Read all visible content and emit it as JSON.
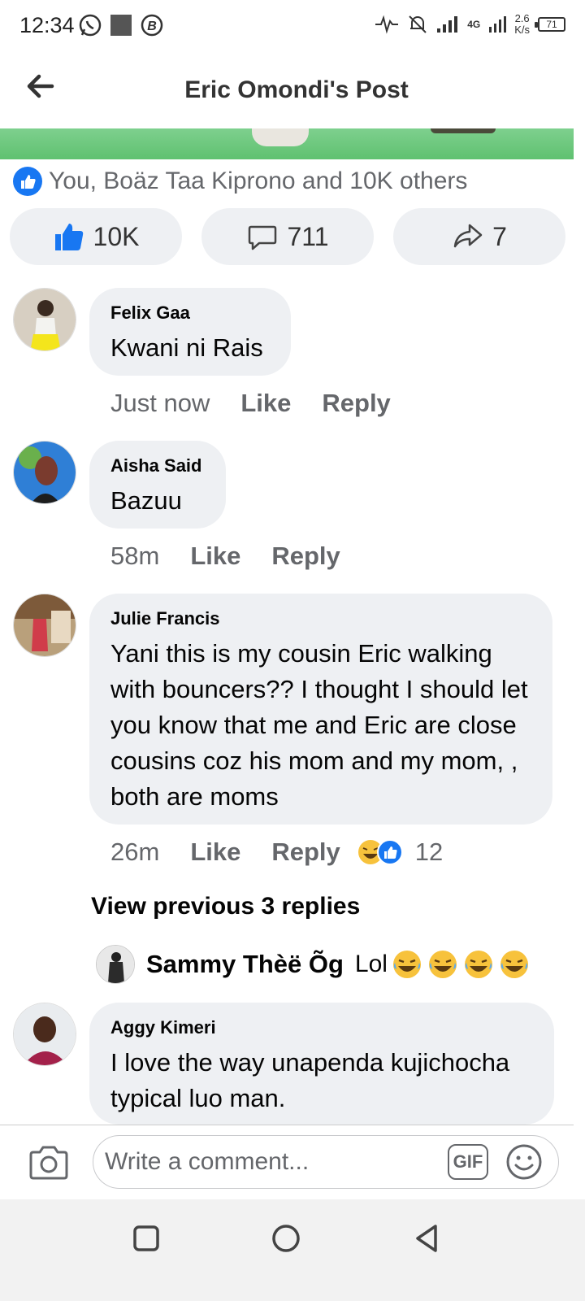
{
  "status": {
    "time": "12:34",
    "network": "4G",
    "speed_value": "2.6",
    "speed_unit": "K/s",
    "battery": "71"
  },
  "header": {
    "title": "Eric Omondi's Post"
  },
  "reactions_summary": "You, Boäz Taa Kiprono and 10K others",
  "actions": {
    "likes": "10K",
    "comments": "711",
    "shares": "7"
  },
  "comments": [
    {
      "name": "Felix Gaa",
      "text": "Kwani ni Rais",
      "time": "Just now",
      "like": "Like",
      "reply": "Reply"
    },
    {
      "name": "Aisha Said",
      "text": "Bazuu",
      "time": "58m",
      "like": "Like",
      "reply": "Reply"
    },
    {
      "name": "Julie Francis",
      "text": "Yani this is my cousin Eric walking with bouncers?? I thought I should let you know that me and Eric are close cousins coz his mom and my mom, , both are moms",
      "time": "26m",
      "like": "Like",
      "reply": "Reply",
      "reaction_count": "12"
    },
    {
      "name": "Aggy Kimeri",
      "text": "I love the way unapenda kujichocha typical luo man."
    }
  ],
  "view_previous": "View previous 3 replies",
  "latest_reply": {
    "name": "Sammy Thèë Õg",
    "text": "Lol"
  },
  "composer": {
    "placeholder": "Write a comment...",
    "gif_label": "GIF"
  },
  "colors": {
    "brand_blue": "#1877f2",
    "bubble_bg": "#eef0f3",
    "secondary_text": "#65676b"
  }
}
